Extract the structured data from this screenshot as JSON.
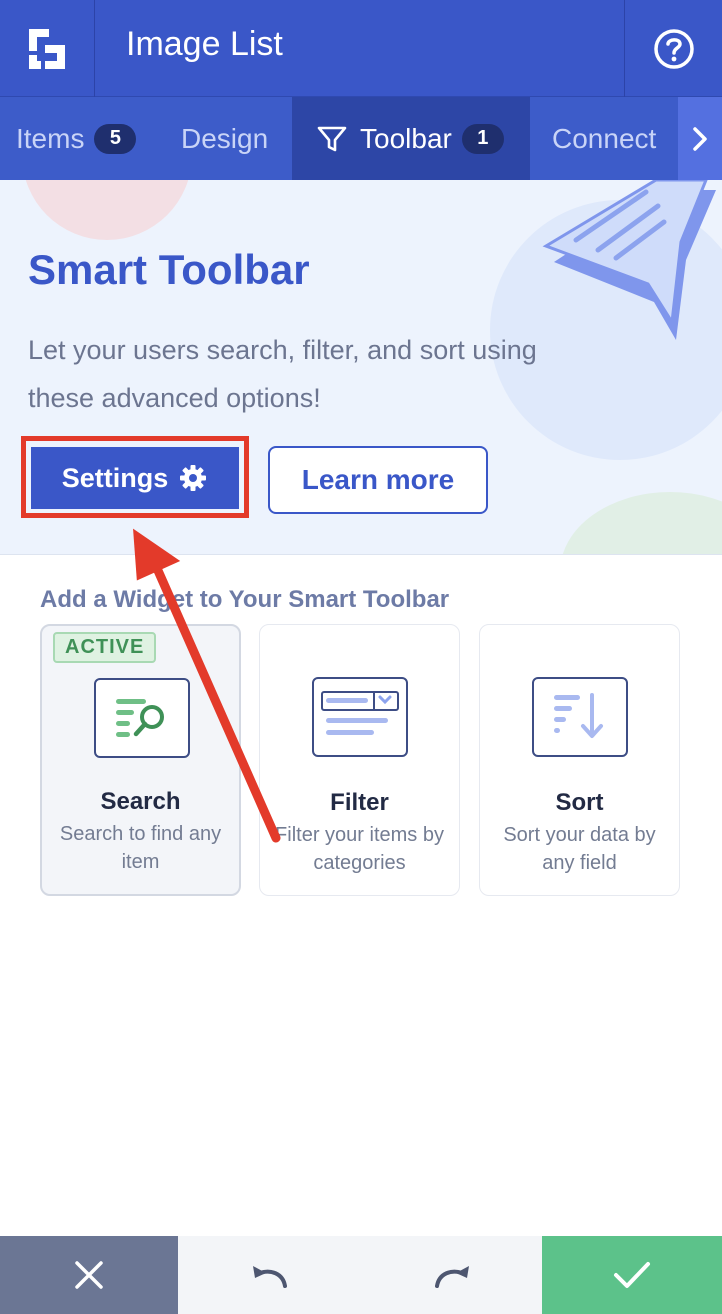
{
  "header": {
    "title": "Image List",
    "logo_icon": "elfsight-logo-icon",
    "help_icon": "question-circle-icon"
  },
  "tabs": [
    {
      "label": "Items",
      "badge": "5",
      "active": false
    },
    {
      "label": "Design",
      "badge": "",
      "active": false
    },
    {
      "label": "Toolbar",
      "badge": "1",
      "active": true,
      "icon": "filter-funnel-icon"
    },
    {
      "label": "Connect",
      "badge": "",
      "active": false
    }
  ],
  "hero": {
    "title": "Smart Toolbar",
    "description": "Let your users search, filter, and sort using these advanced options!",
    "settings_label": "Settings",
    "learn_more_label": "Learn more"
  },
  "widgets": {
    "section_title": "Add a Widget to Your Smart Toolbar",
    "items": [
      {
        "title": "Search",
        "description": "Search to find any item",
        "status": "ACTIVE",
        "icon": "search-widget-icon"
      },
      {
        "title": "Filter",
        "description": "Filter your items by categories",
        "status": "",
        "icon": "filter-widget-icon"
      },
      {
        "title": "Sort",
        "description": "Sort your data by any field",
        "status": "",
        "icon": "sort-widget-icon"
      }
    ]
  },
  "footer": {
    "cancel_icon": "close-icon",
    "undo_icon": "undo-icon",
    "redo_icon": "redo-icon",
    "confirm_icon": "checkmark-icon"
  },
  "colors": {
    "primary": "#3a57c8",
    "tab_active": "#2d46a6",
    "highlight": "#e33a2a",
    "active_green": "#3f9157",
    "confirm": "#5cc28a",
    "cancel": "#6b7694"
  }
}
